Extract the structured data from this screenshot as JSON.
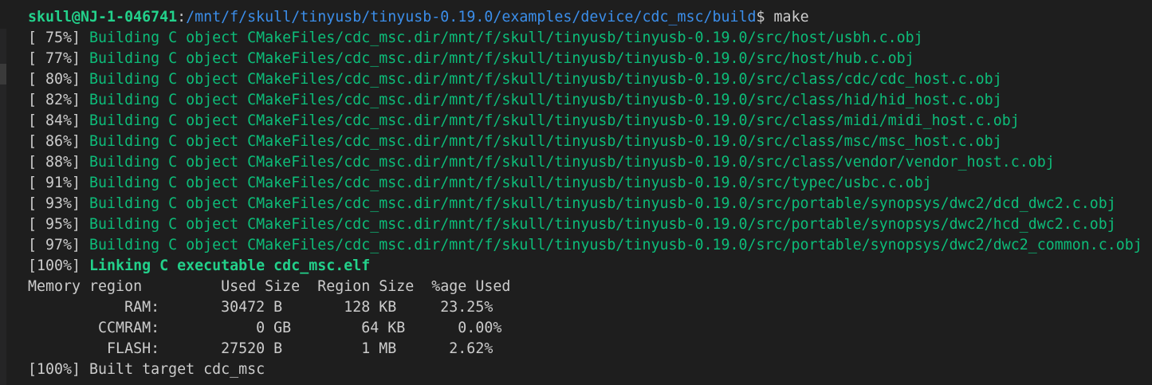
{
  "prompt": {
    "user_host": "skull@NJ-1-046741",
    "separator": ":",
    "path": "/mnt/f/skull/tinyusb/tinyusb-0.19.0/examples/device/cdc_msc/build",
    "symbol": "$",
    "command": " make"
  },
  "build_lines": [
    {
      "pct": "[ 75%] ",
      "text": "Building C object CMakeFiles/cdc_msc.dir/mnt/f/skull/tinyusb/tinyusb-0.19.0/src/host/usbh.c.obj"
    },
    {
      "pct": "[ 77%] ",
      "text": "Building C object CMakeFiles/cdc_msc.dir/mnt/f/skull/tinyusb/tinyusb-0.19.0/src/host/hub.c.obj"
    },
    {
      "pct": "[ 80%] ",
      "text": "Building C object CMakeFiles/cdc_msc.dir/mnt/f/skull/tinyusb/tinyusb-0.19.0/src/class/cdc/cdc_host.c.obj"
    },
    {
      "pct": "[ 82%] ",
      "text": "Building C object CMakeFiles/cdc_msc.dir/mnt/f/skull/tinyusb/tinyusb-0.19.0/src/class/hid/hid_host.c.obj"
    },
    {
      "pct": "[ 84%] ",
      "text": "Building C object CMakeFiles/cdc_msc.dir/mnt/f/skull/tinyusb/tinyusb-0.19.0/src/class/midi/midi_host.c.obj"
    },
    {
      "pct": "[ 86%] ",
      "text": "Building C object CMakeFiles/cdc_msc.dir/mnt/f/skull/tinyusb/tinyusb-0.19.0/src/class/msc/msc_host.c.obj"
    },
    {
      "pct": "[ 88%] ",
      "text": "Building C object CMakeFiles/cdc_msc.dir/mnt/f/skull/tinyusb/tinyusb-0.19.0/src/class/vendor/vendor_host.c.obj"
    },
    {
      "pct": "[ 91%] ",
      "text": "Building C object CMakeFiles/cdc_msc.dir/mnt/f/skull/tinyusb/tinyusb-0.19.0/src/typec/usbc.c.obj"
    },
    {
      "pct": "[ 93%] ",
      "text": "Building C object CMakeFiles/cdc_msc.dir/mnt/f/skull/tinyusb/tinyusb-0.19.0/src/portable/synopsys/dwc2/dcd_dwc2.c.obj"
    },
    {
      "pct": "[ 95%] ",
      "text": "Building C object CMakeFiles/cdc_msc.dir/mnt/f/skull/tinyusb/tinyusb-0.19.0/src/portable/synopsys/dwc2/hcd_dwc2.c.obj"
    },
    {
      "pct": "[ 97%] ",
      "text": "Building C object CMakeFiles/cdc_msc.dir/mnt/f/skull/tinyusb/tinyusb-0.19.0/src/portable/synopsys/dwc2/dwc2_common.c.obj"
    }
  ],
  "link_line": {
    "pct": "[100%] ",
    "text": "Linking C executable cdc_msc.elf"
  },
  "memory_table": {
    "header": "Memory region         Used Size  Region Size  %age Used",
    "rows": [
      "           RAM:       30472 B       128 KB     23.25%",
      "        CCMRAM:           0 GB        64 KB      0.00%",
      "         FLASH:       27520 B         1 MB      2.62%"
    ]
  },
  "final_line": "[100%] Built target cdc_msc",
  "colors": {
    "background": "#1e1e1e",
    "prompt_user": "#23d18b",
    "prompt_path": "#3b8eea",
    "build_text": "#0dbc79",
    "default_text": "#cccccc"
  }
}
